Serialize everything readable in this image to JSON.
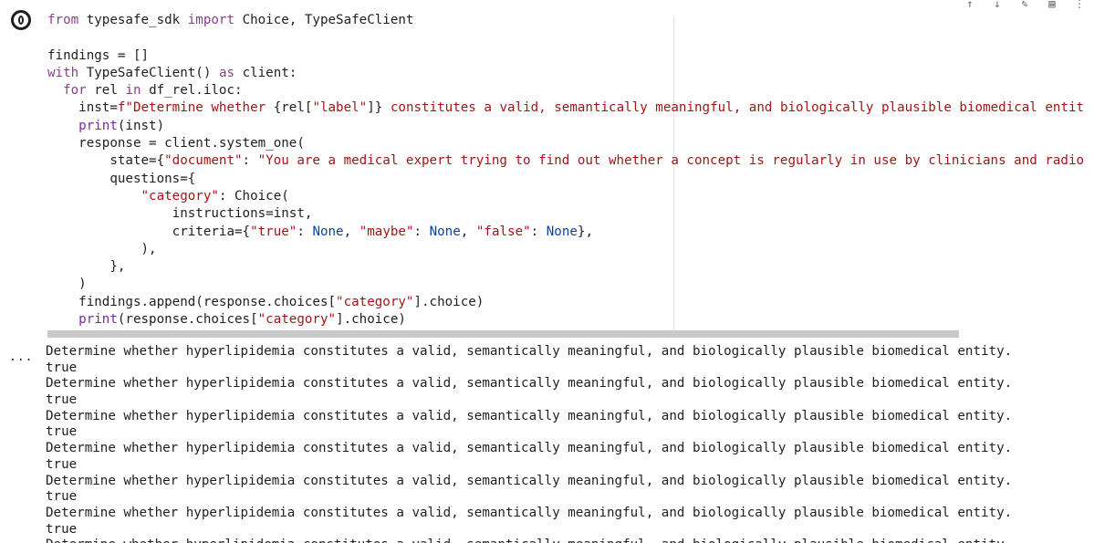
{
  "toolbar": {
    "icons": [
      "arrow-up-icon",
      "arrow-down-icon",
      "edit-icon",
      "delete-icon",
      "more-icon"
    ]
  },
  "code_lines": [
    [
      [
        "kw",
        "from "
      ],
      [
        "t",
        "typesafe_sdk "
      ],
      [
        "kw",
        "import "
      ],
      [
        "t",
        "Choice, TypeSafeClient"
      ]
    ],
    [
      [
        "t",
        ""
      ]
    ],
    [
      [
        "t",
        "findings = []"
      ]
    ],
    [
      [
        "kw",
        "with "
      ],
      [
        "t",
        "TypeSafeClient() "
      ],
      [
        "kw",
        "as "
      ],
      [
        "t",
        "client:"
      ]
    ],
    [
      [
        "t",
        "  "
      ],
      [
        "kw",
        "for "
      ],
      [
        "t",
        "rel "
      ],
      [
        "kw",
        "in "
      ],
      [
        "t",
        "df_rel.iloc:"
      ]
    ],
    [
      [
        "t",
        "    inst="
      ],
      [
        "str",
        "f\"Determine whether "
      ],
      [
        "t",
        "{rel["
      ],
      [
        "str",
        "\"label\""
      ],
      [
        "t",
        "]}"
      ],
      [
        "str",
        " constitutes a valid, semantically meaningful, and biologically plausible biomedical entit"
      ]
    ],
    [
      [
        "t",
        "    "
      ],
      [
        "kw2",
        "print"
      ],
      [
        "t",
        "(inst)"
      ]
    ],
    [
      [
        "t",
        "    response = client.system_one("
      ]
    ],
    [
      [
        "t",
        "        state={"
      ],
      [
        "str",
        "\"document\""
      ],
      [
        "t",
        ": "
      ],
      [
        "str",
        "\"You are a medical expert trying to find out whether a concept is regularly in use by clinicians and radio"
      ]
    ],
    [
      [
        "t",
        "        questions={"
      ]
    ],
    [
      [
        "t",
        "            "
      ],
      [
        "str",
        "\"category\""
      ],
      [
        "t",
        ": Choice("
      ]
    ],
    [
      [
        "t",
        "                instructions=inst,"
      ]
    ],
    [
      [
        "t",
        "                criteria={"
      ],
      [
        "str",
        "\"true\""
      ],
      [
        "t",
        ": "
      ],
      [
        "const",
        "None"
      ],
      [
        "t",
        ", "
      ],
      [
        "str",
        "\"maybe\""
      ],
      [
        "t",
        ": "
      ],
      [
        "const",
        "None"
      ],
      [
        "t",
        ", "
      ],
      [
        "str",
        "\"false\""
      ],
      [
        "t",
        ": "
      ],
      [
        "const",
        "None"
      ],
      [
        "t",
        "},"
      ]
    ],
    [
      [
        "t",
        "            ),"
      ]
    ],
    [
      [
        "t",
        "        },"
      ]
    ],
    [
      [
        "t",
        "    )"
      ]
    ],
    [
      [
        "t",
        "    findings.append(response.choices["
      ],
      [
        "str",
        "\"category\""
      ],
      [
        "t",
        "].choice)"
      ]
    ],
    [
      [
        "t",
        "    "
      ],
      [
        "kw2",
        "print"
      ],
      [
        "t",
        "(response.choices["
      ],
      [
        "str",
        "\"category\""
      ],
      [
        "t",
        "].choice)"
      ]
    ]
  ],
  "output": {
    "marker": "...",
    "lines": [
      "Determine whether hyperlipidemia constitutes a valid, semantically meaningful, and biologically plausible biomedical entity.",
      "true",
      "Determine whether hyperlipidemia constitutes a valid, semantically meaningful, and biologically plausible biomedical entity.",
      "true",
      "Determine whether hyperlipidemia constitutes a valid, semantically meaningful, and biologically plausible biomedical entity.",
      "true",
      "Determine whether hyperlipidemia constitutes a valid, semantically meaningful, and biologically plausible biomedical entity.",
      "true",
      "Determine whether hyperlipidemia constitutes a valid, semantically meaningful, and biologically plausible biomedical entity.",
      "true",
      "Determine whether hyperlipidemia constitutes a valid, semantically meaningful, and biologically plausible biomedical entity.",
      "true",
      "Determine whether hyperlipidemia constitutes a valid, semantically meaningful, and biologically plausible biomedical entity."
    ]
  }
}
